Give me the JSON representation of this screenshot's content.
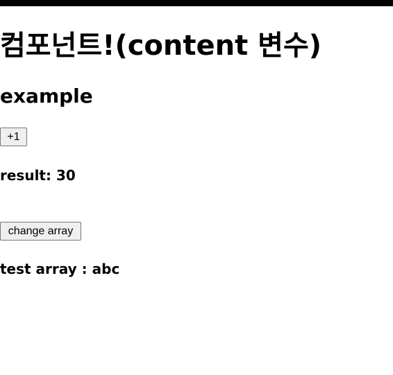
{
  "header": {
    "title": "컴포넌트!(content 변수)"
  },
  "example": {
    "heading": "example",
    "increment_button_label": "+1",
    "result_label": "result:",
    "result_value": "30",
    "change_array_button_label": "change array",
    "array_label": "test array :",
    "array_value": "abc"
  },
  "colors": {
    "top_bar": "#000000",
    "background": "#ffffff",
    "button_background": "#efefef",
    "button_border": "#767676"
  }
}
